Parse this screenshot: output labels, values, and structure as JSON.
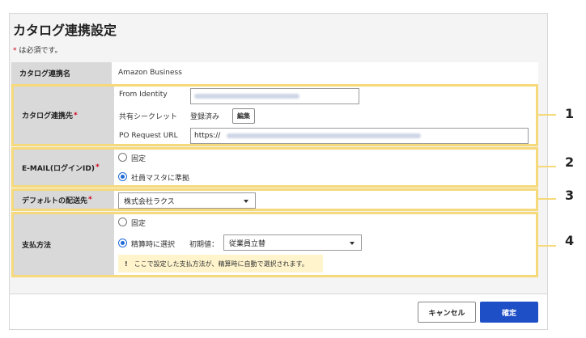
{
  "page": {
    "title": "カタログ連携設定",
    "required_star": "*",
    "required_note": " は必須です。"
  },
  "form": {
    "catalog_name": {
      "label": "カタログ連携名",
      "value": "Amazon Business"
    },
    "catalog_dest": {
      "label": "カタログ連携先",
      "required": "*",
      "from_identity_label": "From Identity",
      "shared_secret_label": "共有シークレット",
      "shared_secret_status": "登録済み",
      "edit_button": "編集",
      "po_request_url_label": "PO Request URL",
      "po_request_url_value": "https://"
    },
    "email": {
      "label": "E-MAIL(ログインID)",
      "required": "*",
      "options": [
        "固定",
        "社員マスタに準拠"
      ],
      "selected_index": 1
    },
    "default_ship": {
      "label": "デフォルトの配送先",
      "required": "*",
      "selected": "株式会社ラクス"
    },
    "payment": {
      "label": "支払方法",
      "option_fixed": "固定",
      "option_select": "精算時に選択",
      "initial_label": "初期値：",
      "initial_value": "従業員立替",
      "info_icon": "!",
      "info_text": "ここで設定した支払方法が、精算時に自動で選択されます。",
      "selected": "option_select"
    }
  },
  "callouts": [
    "1",
    "2",
    "3",
    "4"
  ],
  "footer": {
    "cancel_label": "キャンセル",
    "ok_label": "確定"
  },
  "colors": {
    "highlight": "#f5d97a",
    "primary": "#1f4fc7",
    "required": "#d0021b",
    "radio_on": "#1e6bd6"
  }
}
